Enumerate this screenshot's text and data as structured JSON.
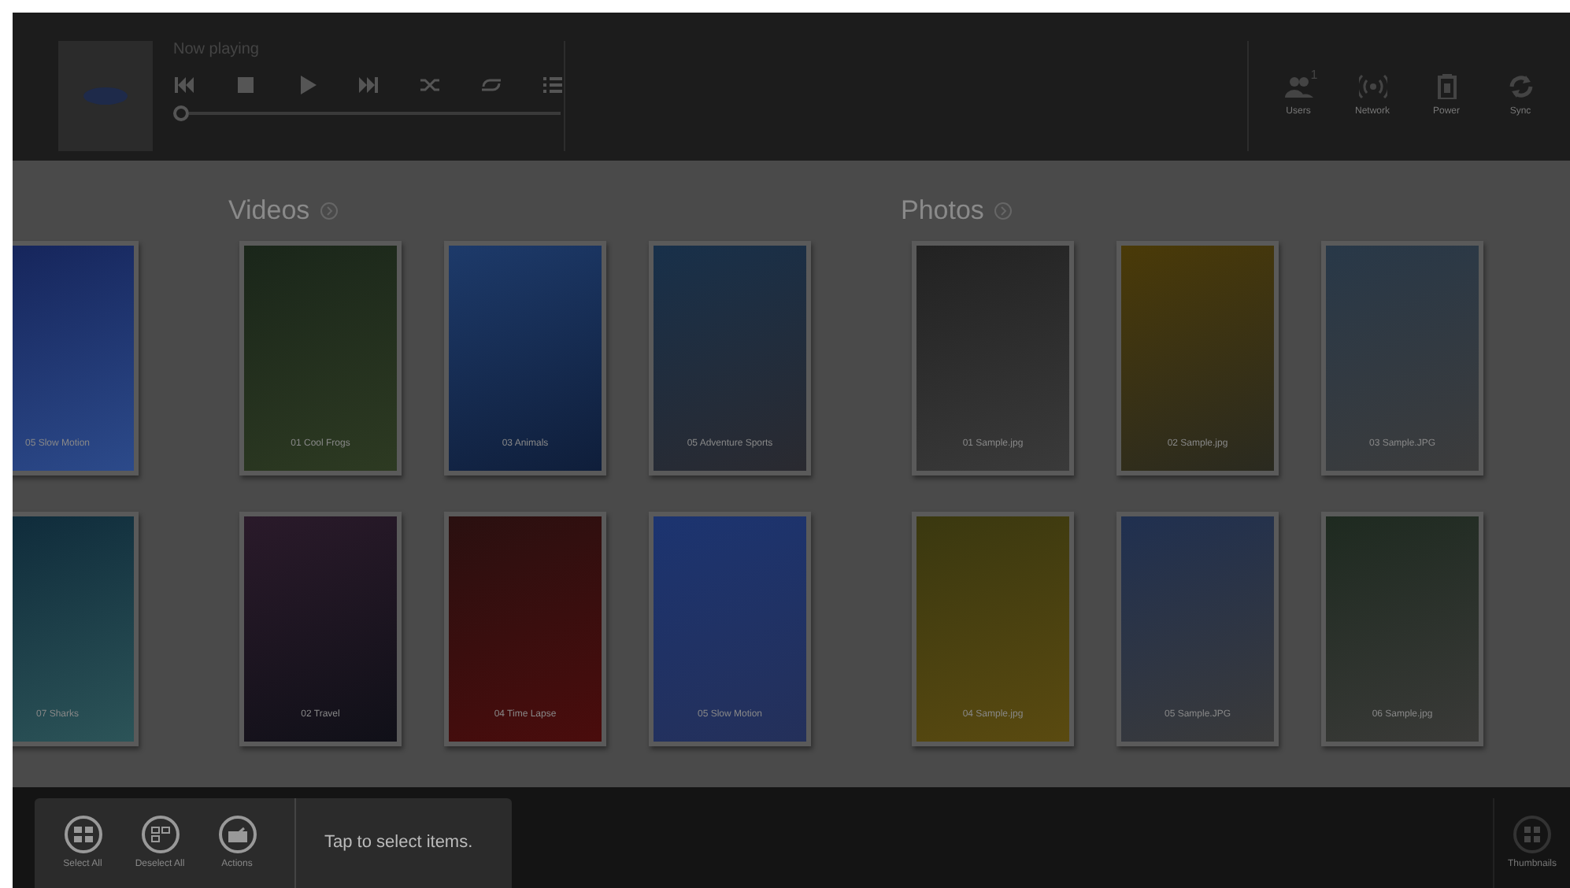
{
  "player": {
    "caption": "Now playing",
    "progress": {
      "level": 0
    }
  },
  "status_items": [
    {
      "label": "Users",
      "kind": "users",
      "badge": "1"
    },
    {
      "label": "Network",
      "kind": "network"
    },
    {
      "label": "Power",
      "kind": "power"
    },
    {
      "label": "Sync",
      "kind": "sync"
    }
  ],
  "sections": [
    {
      "tiles": [
        {
          "caption": "05 Slow Motion"
        },
        {
          "caption": "07 Sharks"
        }
      ]
    },
    {
      "title": "Videos",
      "tiles": [
        {
          "caption": "01 Cool Frogs"
        },
        {
          "caption": "03 Animals"
        },
        {
          "caption": "05 Adventure Sports"
        },
        {
          "caption": "02 Travel"
        },
        {
          "caption": "04 Time Lapse"
        },
        {
          "caption": "05 Slow Motion"
        }
      ]
    },
    {
      "title": "Photos",
      "tiles": [
        {
          "caption": "01 Sample.jpg"
        },
        {
          "caption": "02 Sample.jpg"
        },
        {
          "caption": "03 Sample.JPG"
        },
        {
          "caption": "04 Sample.jpg"
        },
        {
          "caption": "05 Sample.JPG"
        },
        {
          "caption": "06 Sample.jpg"
        }
      ]
    }
  ],
  "app_bar": {
    "commands": [
      {
        "label": "Select All",
        "kind": "select"
      },
      {
        "label": "Deselect All",
        "kind": "deselect"
      },
      {
        "label": "Actions",
        "kind": "actions"
      }
    ],
    "hint": "Tap to select items.",
    "view_button": {
      "label": "Thumbnails"
    }
  }
}
